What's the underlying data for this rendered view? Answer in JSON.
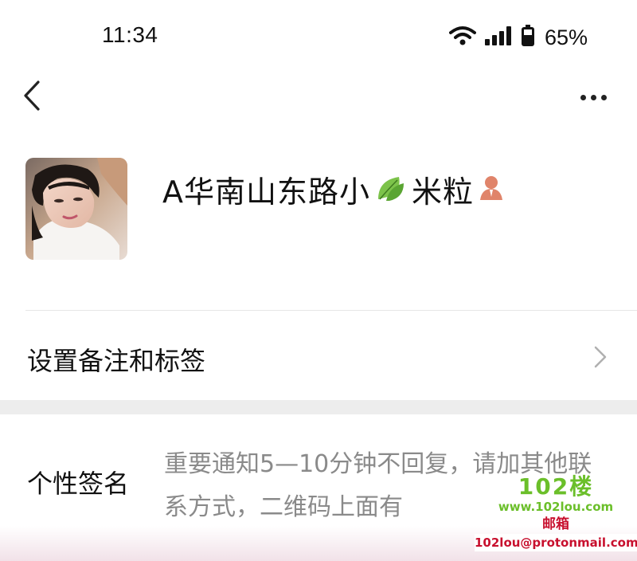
{
  "status_bar": {
    "time": "11:34",
    "battery_percent": "65%",
    "icons": [
      "wifi-icon",
      "cellular-signal-icon",
      "battery-icon"
    ]
  },
  "nav": {
    "back_icon": "chevron-left-icon",
    "more_icon": "more-dots-icon"
  },
  "profile": {
    "nickname_part1": "A华南山东路小",
    "nickname_part2": "米粒",
    "nickname_emoji": "leaf-emoji-icon",
    "nickname_badge": "person-badge-icon"
  },
  "remark_row": {
    "label": "设置备注和标签"
  },
  "signature_row": {
    "label": "个性签名",
    "text": "重要通知5—10分钟不回复，请加其他联系方式，二维码上面有"
  },
  "watermark": {
    "logo": "102楼",
    "url": "www.102lou.com",
    "mail_label": "邮箱",
    "mail": "102lou@protonmail.com"
  },
  "colors": {
    "watermark_green": "#6bbf2a",
    "watermark_red": "#c8102e",
    "secondary_text": "#8a8a8a",
    "section_gap": "#ededed"
  }
}
